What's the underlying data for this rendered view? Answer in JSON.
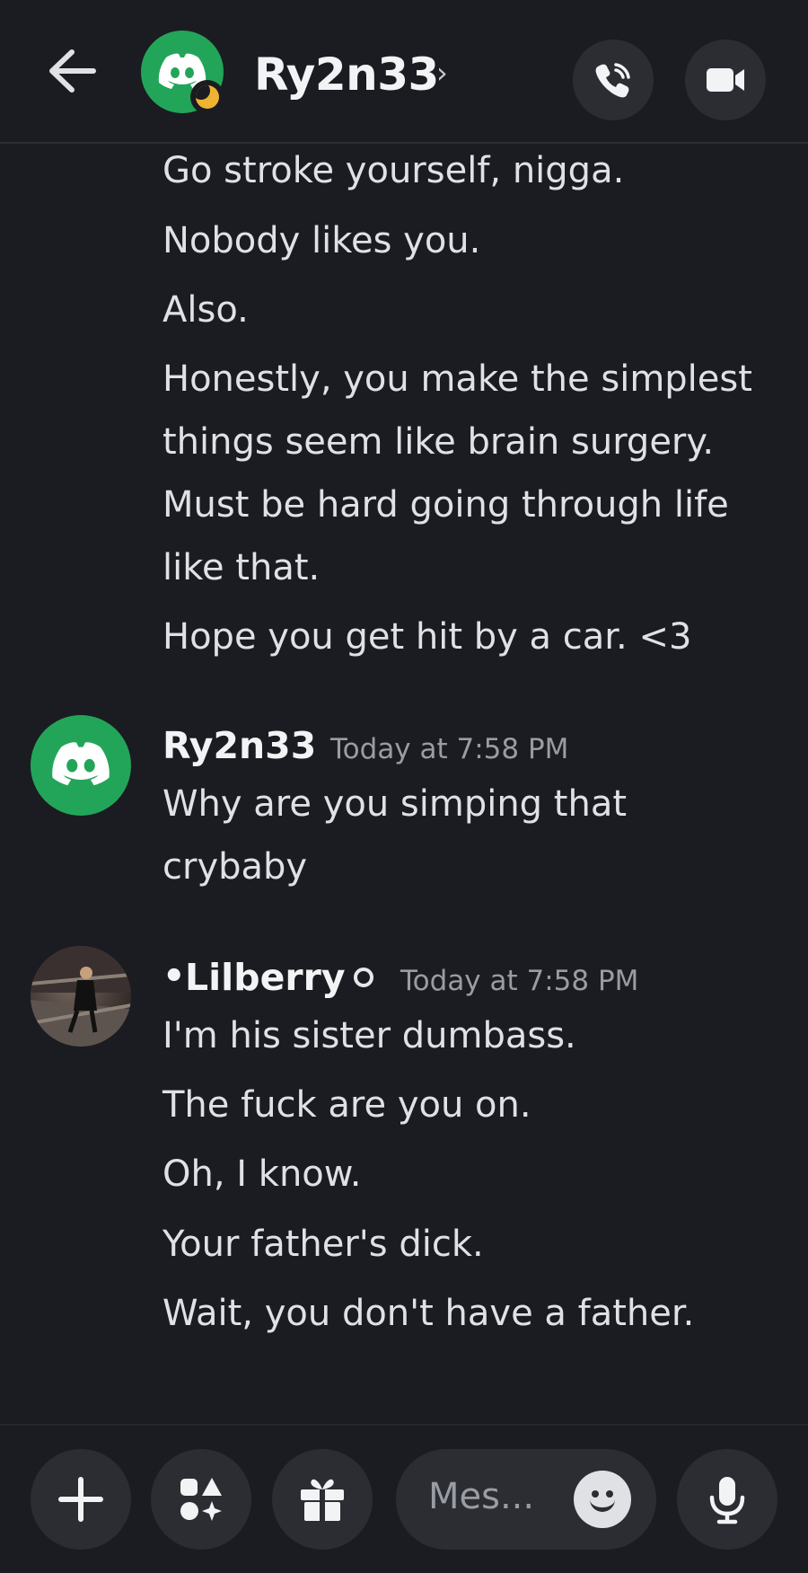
{
  "header": {
    "title": "Ry2n33",
    "chevron": "›",
    "back_icon": "arrow-left-icon",
    "call_icon": "phone-icon",
    "video_icon": "video-camera-icon",
    "status": "idle"
  },
  "continued_messages": [
    "Go stroke yourself, nigga.",
    "Nobody likes you.",
    "Also.",
    "Honestly, you make the simplest",
    "things seem like brain surgery.",
    "Must be hard going through life",
    "like that.",
    "Hope you get hit by a car. <3"
  ],
  "group_ry": {
    "author": "Ry2n33",
    "timestamp": "Today at 7:58 PM",
    "lines": [
      "Why are you simping that",
      "crybaby"
    ]
  },
  "group_lil": {
    "bullet": "•",
    "author": "Lilberry",
    "timestamp": "Today at 7:58 PM",
    "lines": [
      "I'm his sister dumbass.",
      "The fuck are you on.",
      "Oh, I know.",
      "Your father's dick.",
      "Wait, you don't have a father."
    ]
  },
  "composer": {
    "placeholder": "Mes...",
    "plus_icon": "plus-icon",
    "apps_icon": "apps-icon",
    "gift_icon": "gift-icon",
    "emoji_icon": "emoji-icon",
    "mic_icon": "microphone-icon"
  },
  "colors": {
    "background": "#1b1c21",
    "avatar_green": "#23a559",
    "idle_status": "#f0b232",
    "button_bg": "#2b2d33"
  }
}
